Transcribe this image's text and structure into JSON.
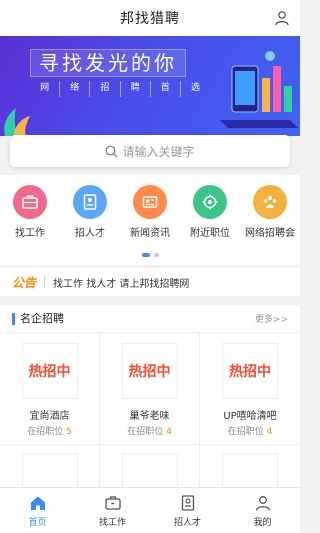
{
  "header": {
    "title": "邦找猎聘",
    "user_icon": "user-icon"
  },
  "banner": {
    "headline": "寻找发光的你",
    "subline": [
      "网",
      "络",
      "招",
      "聘",
      "首",
      "选"
    ]
  },
  "search": {
    "placeholder": "请输入关键字",
    "icon": "search-icon"
  },
  "quick_links": [
    {
      "label": "找工作",
      "icon": "briefcase-icon",
      "color": "#f0698a"
    },
    {
      "label": "招人才",
      "icon": "resume-icon",
      "color": "#5aa7f5"
    },
    {
      "label": "新闻资讯",
      "icon": "news-icon",
      "color": "#ff8a4c"
    },
    {
      "label": "附近职位",
      "icon": "location-icon",
      "color": "#3cc48a"
    },
    {
      "label": "网络招聘会",
      "icon": "people-icon",
      "color": "#f5b13d"
    }
  ],
  "carousel": {
    "page_count": 2,
    "active_index": 0
  },
  "notice": {
    "tag": "公告",
    "text": "找工作 找人才 请上邦找招聘网"
  },
  "famous": {
    "title": "名企招聘",
    "more": "更多>>",
    "cards": [
      {
        "logo_text": "热招中",
        "name": "宜尚酒店",
        "count_label": "在招职位",
        "count": "5"
      },
      {
        "logo_text": "热招中",
        "name": "巢爷老味",
        "count_label": "在招职位",
        "count": "4"
      },
      {
        "logo_text": "热招中",
        "name": "UP嘻哈清吧",
        "count_label": "在招职位",
        "count": "4"
      }
    ]
  },
  "tabbar": {
    "active": 0,
    "tabs": [
      {
        "label": "首页",
        "icon": "home-icon"
      },
      {
        "label": "找工作",
        "icon": "briefcase-icon"
      },
      {
        "label": "招人才",
        "icon": "resume-icon"
      },
      {
        "label": "我的",
        "icon": "user-icon"
      }
    ]
  },
  "colors": {
    "accent": "#3c8cf0",
    "hot": "#ff4a2d",
    "notice": "#ff8c00"
  }
}
